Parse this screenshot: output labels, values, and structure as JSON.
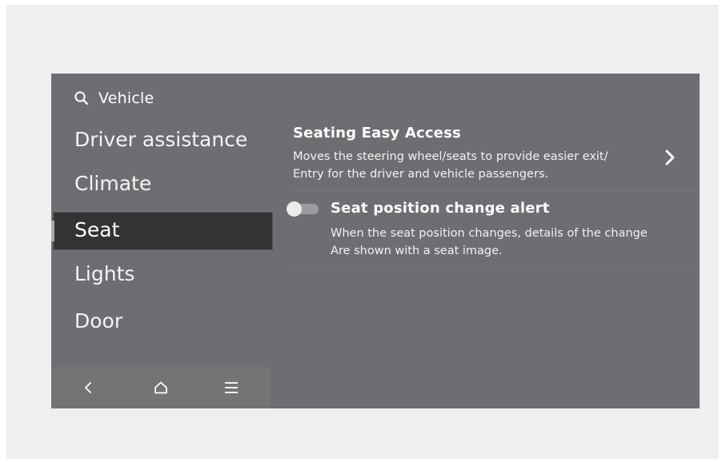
{
  "header": {
    "icon": "search-icon",
    "title": "Vehicle"
  },
  "sidebar": {
    "items": [
      {
        "label": "Driver assistance",
        "selected": false
      },
      {
        "label": "Climate",
        "selected": false
      },
      {
        "label": "Seat",
        "selected": true
      },
      {
        "label": "Lights",
        "selected": false
      },
      {
        "label": "Door",
        "selected": false
      }
    ]
  },
  "bottom_bar": {
    "buttons": [
      {
        "icon": "back-icon"
      },
      {
        "icon": "home-icon"
      },
      {
        "icon": "menu-icon"
      }
    ]
  },
  "settings": {
    "seating_easy_access": {
      "title": "Seating Easy Access",
      "description_line1": "Moves the steering wheel/seats to provide easier exit/",
      "description_line2": "Entry for the driver and vehicle passengers.",
      "icon": "chevron-right-icon"
    },
    "seat_position_alert": {
      "title": "Seat position change alert",
      "description_line1": "When the seat position changes, details of the change",
      "description_line2": "Are shown with a seat image.",
      "toggle_state": "off"
    }
  },
  "colors": {
    "screen_background": "#6d6e71",
    "selected_item_background": "#333333",
    "text": "#ffffff"
  }
}
